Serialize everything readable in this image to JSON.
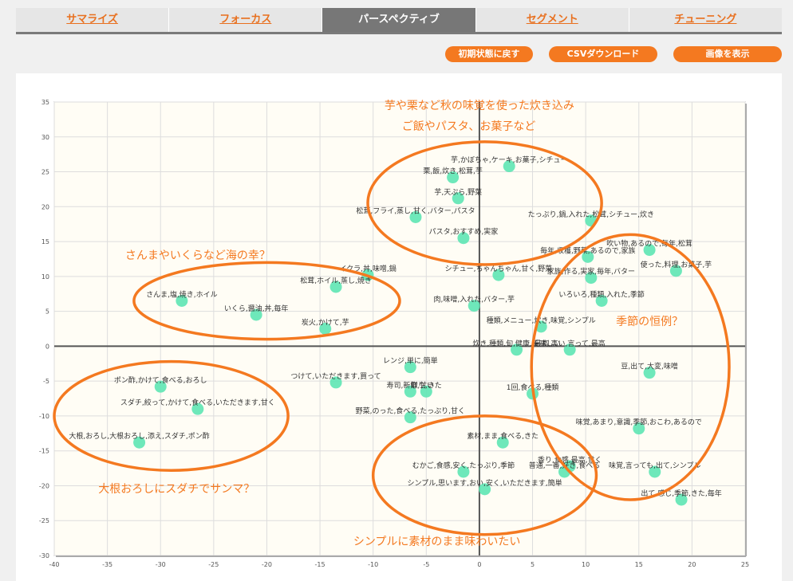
{
  "tabs": [
    {
      "label": "サマライズ",
      "active": false
    },
    {
      "label": "フォーカス",
      "active": false
    },
    {
      "label": "パースペクティブ",
      "active": true
    },
    {
      "label": "セグメント",
      "active": false
    },
    {
      "label": "チューニング",
      "active": false
    }
  ],
  "toolbar": {
    "reset_label": "初期状態に戻す",
    "csv_label": "CSVダウンロード",
    "image_label": "画像を表示"
  },
  "chart_data": {
    "type": "scatter",
    "xlim": [
      -40,
      25
    ],
    "ylim": [
      -30,
      35
    ],
    "x_ticks": [
      -40,
      -35,
      -30,
      -25,
      -20,
      -15,
      -10,
      -5,
      0,
      5,
      10,
      15,
      20,
      25
    ],
    "y_ticks": [
      35,
      30,
      25,
      20,
      15,
      10,
      5,
      0,
      -5,
      -10,
      -15,
      -20,
      -25,
      -30
    ],
    "grid": true,
    "point_color": "#5ee6b4",
    "accent_color": "#f47920",
    "points": [
      {
        "x": 2.8,
        "y": 25.8,
        "label": "芋,かぼちゃ,ケーキ,お菓子,シチュー"
      },
      {
        "x": -2.5,
        "y": 24.2,
        "label": "栗,飯,炊き,松茸,芋"
      },
      {
        "x": -2.0,
        "y": 21.2,
        "label": "芋,天ぷら,野菜"
      },
      {
        "x": -6.0,
        "y": 18.5,
        "label": "松茸,フライ,蒸し,甘く,バター,パスタ"
      },
      {
        "x": 10.5,
        "y": 18.0,
        "label": "たっぷり,鍋,入れた,松茸,シチュー,炊き"
      },
      {
        "x": -1.5,
        "y": 15.5,
        "label": "パスタ,おすすめ,実家"
      },
      {
        "x": 16.0,
        "y": 13.8,
        "label": "吹い物,あるので,毎年,松茸"
      },
      {
        "x": 10.2,
        "y": 12.8,
        "label": "毎年,収穫,野菜,あるので,家族"
      },
      {
        "x": 18.5,
        "y": 10.8,
        "label": "使った,料理,お菓子,芋"
      },
      {
        "x": 1.8,
        "y": 10.2,
        "label": "シチュー,ちゃんちゃん,甘く,野菜"
      },
      {
        "x": 10.5,
        "y": 9.8,
        "label": "家族,作る,実家,毎年,バター"
      },
      {
        "x": -13.5,
        "y": 8.5,
        "label": "松茸,ホイル,蒸し,焼き"
      },
      {
        "x": -10.5,
        "y": 10.2,
        "label": "イクラ,丼,味噌,鍋"
      },
      {
        "x": -28.0,
        "y": 6.5,
        "label": "さんま,塩,焼き,ホイル"
      },
      {
        "x": 11.5,
        "y": 6.5,
        "label": "いろいろ,種類,入れた,季節"
      },
      {
        "x": -21.0,
        "y": 4.5,
        "label": "いくら,醤油,丼,毎年"
      },
      {
        "x": -0.5,
        "y": 5.8,
        "label": "肉,味噌,入れた,バター,芋"
      },
      {
        "x": -14.5,
        "y": 2.5,
        "label": "炭火,かけて,芋"
      },
      {
        "x": 5.8,
        "y": 2.8,
        "label": "種類,メニュー,炊き,味覚,シンプル"
      },
      {
        "x": 3.5,
        "y": -0.5,
        "label": "炊き,種類,旬,健康,美味しい"
      },
      {
        "x": 8.5,
        "y": -0.5,
        "label": "最高,高い,言って,最高"
      },
      {
        "x": -6.5,
        "y": -3.0,
        "label": "レンジ,単に,簡単"
      },
      {
        "x": 16.0,
        "y": -3.8,
        "label": "豆,出て,大変,味噌"
      },
      {
        "x": -13.5,
        "y": -5.2,
        "label": "つけて,いただきます,買って"
      },
      {
        "x": -30.0,
        "y": -5.8,
        "label": "ポン酢,かけて,食べる,おろし"
      },
      {
        "x": -6.5,
        "y": -6.5,
        "label": "寿司,新鮮,甘い"
      },
      {
        "x": -5.0,
        "y": -6.5,
        "label": "取り,きた"
      },
      {
        "x": 5.0,
        "y": -6.8,
        "label": "1回,食べる,種類"
      },
      {
        "x": -26.5,
        "y": -9.0,
        "label": "スダチ,絞って,かけて,食べる,いただきます,甘く"
      },
      {
        "x": -6.5,
        "y": -10.2,
        "label": "野菜,のった,食べる,たっぷり,甘く"
      },
      {
        "x": 15.0,
        "y": -11.8,
        "label": "味覚,あまり,意識,季節,おこわ,あるので"
      },
      {
        "x": -32.0,
        "y": -13.8,
        "label": "大根,おろし,大根おろし,添え,スダチ,ポン酢"
      },
      {
        "x": 2.2,
        "y": -13.8,
        "label": "素材,まま,食べる,きた"
      },
      {
        "x": 8.5,
        "y": -17.2,
        "label": "香り,食感,最高,甘く"
      },
      {
        "x": -1.5,
        "y": -18.0,
        "label": "むかご,食感,安く,たっぷり,季節"
      },
      {
        "x": 8.0,
        "y": -18.0,
        "label": "普通,一番,好き,食べる"
      },
      {
        "x": 16.5,
        "y": -18.0,
        "label": "味覚,言っても,出て,シンプル"
      },
      {
        "x": 0.5,
        "y": -20.5,
        "label": "シンプル,思います,おい,安く,いただきます,簡単"
      },
      {
        "x": 19.0,
        "y": -22.0,
        "label": "出て,感じ,季節,きた,毎年"
      }
    ],
    "annotations": [
      {
        "text": "芋や栗など秋の味覚を使った炊き込み",
        "x": 0.0,
        "y": 34.0
      },
      {
        "text": "ご飯やパスタ、お菓子など",
        "x": -1.0,
        "y": 31.0
      },
      {
        "text": "さんまやいくらなど海の幸？",
        "x": -26.5,
        "y": 12.5
      },
      {
        "text": "季節の恒例？",
        "x": 16.0,
        "y": 3.0
      },
      {
        "text": "大根おろしにスダチでサンマ？",
        "x": -28.5,
        "y": -21.0
      },
      {
        "text": "シンプルに素材のまま味わいたい",
        "x": -4.0,
        "y": -28.5
      }
    ],
    "ellipses": [
      {
        "cx": 0.5,
        "cy": 20.5,
        "rx": 11.0,
        "ry": 8.8
      },
      {
        "cx": -20.0,
        "cy": 6.5,
        "rx": 12.5,
        "ry": 5.5
      },
      {
        "cx": 14.2,
        "cy": -3.0,
        "rx": 9.3,
        "ry": 19.0
      },
      {
        "cx": -29.0,
        "cy": -10.0,
        "rx": 11.0,
        "ry": 7.8
      },
      {
        "cx": 0.5,
        "cy": -18.5,
        "rx": 10.5,
        "ry": 8.5
      }
    ]
  }
}
